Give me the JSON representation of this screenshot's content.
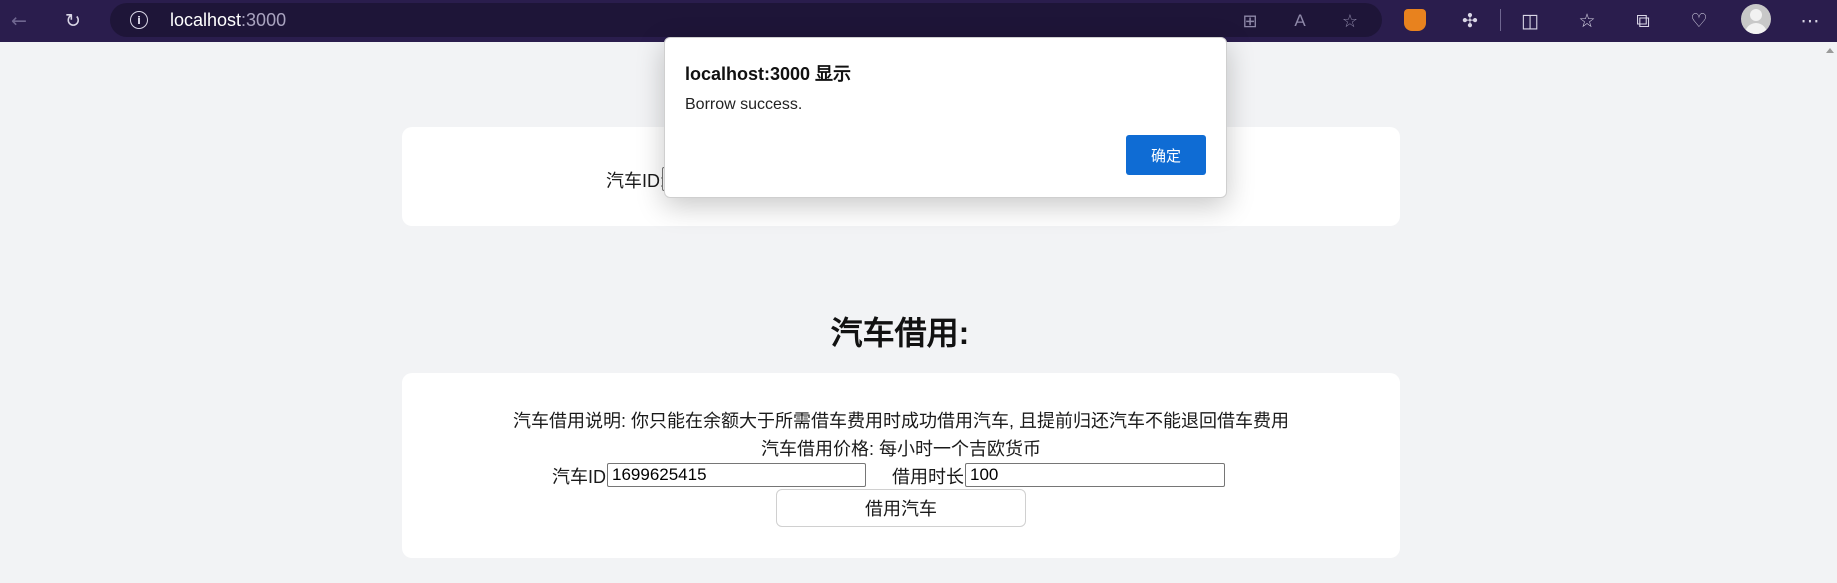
{
  "browser": {
    "url_host": "localhost",
    "url_port": ":3000"
  },
  "page": {
    "top_section": {
      "car_id_label": "汽车ID:"
    },
    "borrow_section": {
      "title": "汽车借用:",
      "description": "汽车借用说明: 你只能在余额大于所需借车费用时成功借用汽车, 且提前归还汽车不能退回借车费用",
      "price": "汽车借用价格: 每小时一个吉欧货币",
      "car_id_label": "汽车ID:",
      "car_id_value": "1699625415",
      "duration_label": "借用时长:",
      "duration_value": "100",
      "button_label": "借用汽车"
    }
  },
  "dialog": {
    "title": "localhost:3000 显示",
    "message": "Borrow success.",
    "ok_label": "确定"
  },
  "colors": {
    "toolbar_bg": "#2a1d4d",
    "page_bg": "#f2f3f5",
    "ok_button": "#0f6cd4"
  }
}
